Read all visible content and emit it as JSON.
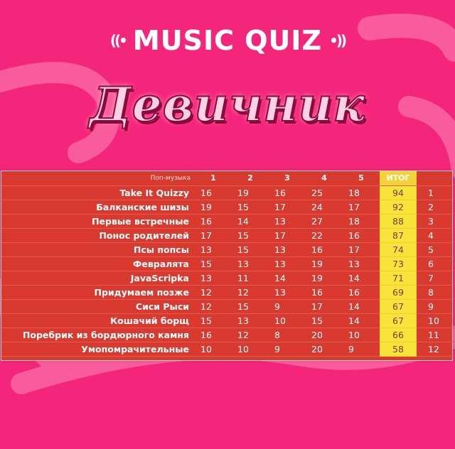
{
  "header": {
    "title": "MUSIC QUIZ",
    "subtitle": "Девичник"
  },
  "table": {
    "category": "Поп-музыка",
    "columns": [
      "1",
      "2",
      "3",
      "4",
      "5",
      "ИТОГ",
      ""
    ],
    "rows": [
      {
        "team": "Take It Quizzy",
        "scores": [
          "16",
          "19",
          "16",
          "25",
          "18"
        ],
        "total": "94",
        "place": "1"
      },
      {
        "team": "Балканские шизы",
        "scores": [
          "19",
          "15",
          "17",
          "24",
          "17"
        ],
        "total": "92",
        "place": "2"
      },
      {
        "team": "Первые встречные",
        "scores": [
          "16",
          "14",
          "13",
          "27",
          "18"
        ],
        "total": "88",
        "place": "3"
      },
      {
        "team": "Понос родителей",
        "scores": [
          "17",
          "15",
          "17",
          "22",
          "16"
        ],
        "total": "87",
        "place": "4"
      },
      {
        "team": "Псы попсы",
        "scores": [
          "13",
          "15",
          "13",
          "16",
          "17"
        ],
        "total": "74",
        "place": "5"
      },
      {
        "team": "Февралята",
        "scores": [
          "15",
          "13",
          "13",
          "19",
          "13"
        ],
        "total": "73",
        "place": "6"
      },
      {
        "team": "JavaScripka",
        "scores": [
          "13",
          "11",
          "14",
          "19",
          "14"
        ],
        "total": "71",
        "place": "7"
      },
      {
        "team": "Придумаем позже",
        "scores": [
          "12",
          "12",
          "13",
          "16",
          "16"
        ],
        "total": "69",
        "place": "8"
      },
      {
        "team": "Сиси Рыси",
        "scores": [
          "12",
          "15",
          "9",
          "17",
          "14"
        ],
        "total": "67",
        "place": "9"
      },
      {
        "team": "Кошачий борщ",
        "scores": [
          "15",
          "13",
          "10",
          "15",
          "14"
        ],
        "total": "67",
        "place": "10"
      },
      {
        "team": "Поребрик из бордюрного камня",
        "scores": [
          "16",
          "12",
          "8",
          "20",
          "10"
        ],
        "total": "66",
        "place": "11"
      },
      {
        "team": "Умопомрачительные",
        "scores": [
          "10",
          "10",
          "9",
          "20",
          "9"
        ],
        "total": "58",
        "place": "12"
      }
    ]
  },
  "colors": {
    "background": "#f4267c",
    "table": "#d83a2f",
    "total_highlight": "#f7e33a"
  }
}
